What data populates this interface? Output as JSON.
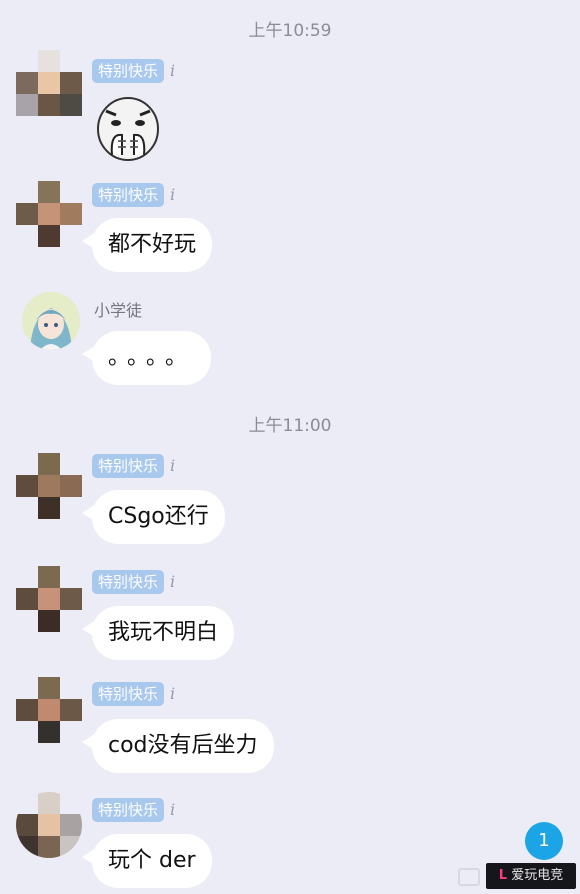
{
  "timestamps": [
    "上午10:59",
    "上午11:00"
  ],
  "messages": [
    {
      "sender_tag": "特别快乐",
      "tag_suffix": "i",
      "content_type": "sticker",
      "sticker_icon": "face-palm-sticker"
    },
    {
      "sender_tag": "特别快乐",
      "tag_suffix": "i",
      "text": "都不好玩"
    },
    {
      "sender_name": "小学徒",
      "text": "。。。。"
    },
    {
      "sender_tag": "特别快乐",
      "tag_suffix": "i",
      "text": "CSgo还行"
    },
    {
      "sender_tag": "特别快乐",
      "tag_suffix": "i",
      "text": "我玩不明白"
    },
    {
      "sender_tag": "特别快乐",
      "tag_suffix": "i",
      "text": "cod没有后坐力"
    },
    {
      "sender_tag": "特别快乐",
      "tag_suffix": "i",
      "text": "玩个 der"
    }
  ],
  "unread_badge": "1",
  "watermark": {
    "mark": "L",
    "text": "爱玩电竞"
  },
  "colors": {
    "background": "#ececf6",
    "tag": "#a9c8ee",
    "badge": "#1ba4e6",
    "bubble": "#ffffff"
  }
}
